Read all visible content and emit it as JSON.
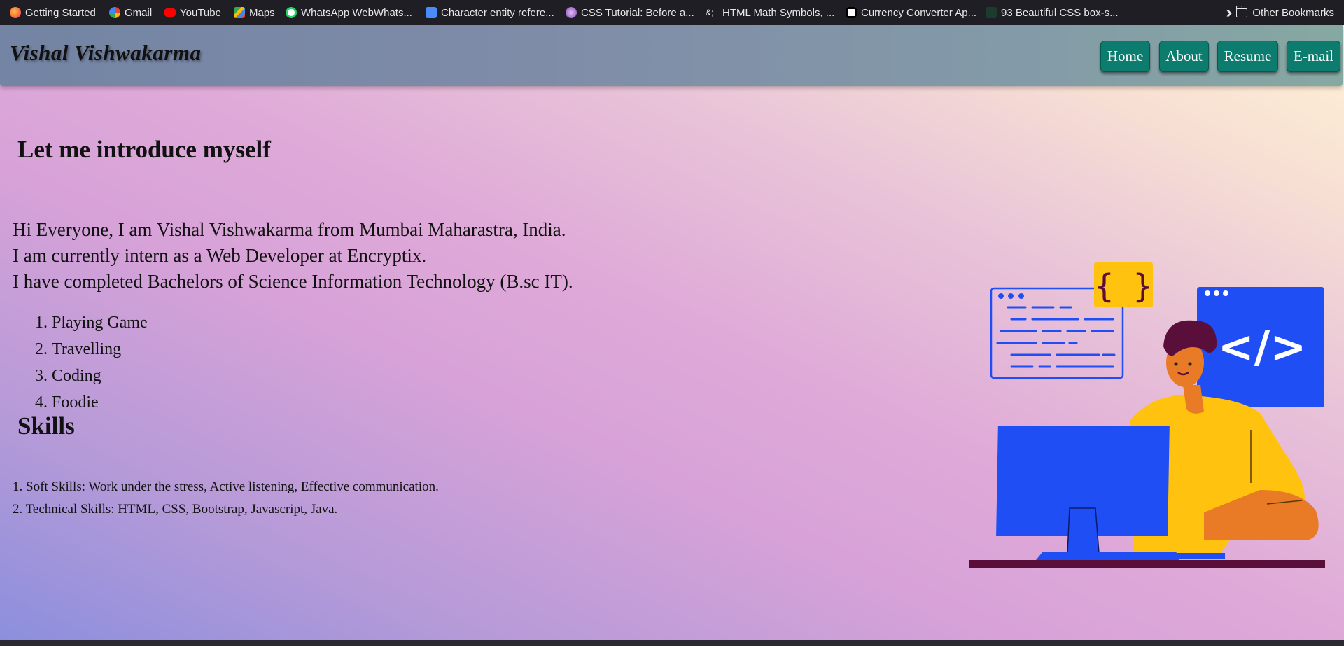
{
  "bookmarks": [
    {
      "label": "Getting Started",
      "icon": "firefox-icon",
      "color": "#ff7139"
    },
    {
      "label": "Gmail",
      "icon": "google-icon",
      "color": "#4285f4"
    },
    {
      "label": "YouTube",
      "icon": "youtube-icon",
      "color": "#ff0000"
    },
    {
      "label": "Maps",
      "icon": "maps-icon",
      "color": "#34a853"
    },
    {
      "label": "WhatsApp WebWhats...",
      "icon": "whatsapp-icon",
      "color": "#25d366"
    },
    {
      "label": "Character entity refere...",
      "icon": "globe-icon",
      "color": "#4a8cf7"
    },
    {
      "label": "CSS Tutorial: Before a...",
      "icon": "avatar-icon",
      "color": "#a06bd8"
    },
    {
      "label": "HTML Math Symbols, ...",
      "icon": "ampersand-icon",
      "color": "#222222"
    },
    {
      "label": "Currency Converter Ap...",
      "icon": "medium-icon",
      "color": "#000000"
    },
    {
      "label": "93 Beautiful CSS box-s...",
      "icon": "cursor-icon",
      "color": "#1d3b2a"
    }
  ],
  "bookmarks_overflow_icon": "double-chevron-icon",
  "other_bookmarks": "Other Bookmarks",
  "brand": "Vishal Vishwakarma",
  "nav": [
    "Home",
    "About",
    "Resume",
    "E-mail"
  ],
  "intro_heading": "Let me introduce myself",
  "intro_lines": [
    "Hi Everyone, I am Vishal Vishwakarma from Mumbai Maharastra, India.",
    "I am currently intern as a Web Developer at Encryptix.",
    "I have completed Bachelors of Science Information Technology (B.sc IT)."
  ],
  "hobbies": [
    "Playing Game",
    "Travelling",
    "Coding",
    "Foodie"
  ],
  "skills_heading": "Skills",
  "skills": [
    "1. Soft Skills: Work under the stress, Active listening, Effective communication.",
    "2. Technical Skills: HTML, CSS, Bootstrap, Javascript, Java."
  ],
  "illustration": {
    "code_braces": "{ }",
    "code_tag": "</>"
  },
  "colors": {
    "nav_button": "#0b7c6e",
    "illus_blue": "#1f4ef5",
    "illus_yellow": "#ffc20e"
  }
}
